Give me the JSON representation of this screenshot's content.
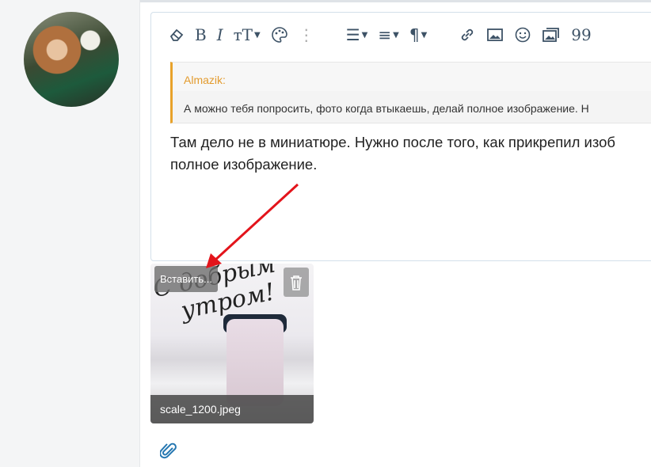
{
  "toolbar": {
    "items": [
      "eraser-icon",
      "bold-icon",
      "italic-icon",
      "text-size-icon",
      "palette-icon",
      "more-icon",
      "list-icon",
      "align-icon",
      "paragraph-icon",
      "link-icon",
      "image-icon",
      "smile-icon",
      "gallery-icon",
      "quote-icon"
    ],
    "bold": "B",
    "italic": "I",
    "text_size": "тT",
    "paragraph": "¶"
  },
  "quote": {
    "author": "Almazik:",
    "text": "А можно тебя попросить, фото когда втыкаешь, делай полное изображение. Н"
  },
  "message": {
    "line1": "Там дело не в миниатюре. Нужно после того, как прикрепил изоб",
    "line2": "полное изображение."
  },
  "attachment": {
    "insert_label": "Вставить...",
    "filename": "scale_1200.jpeg",
    "image_text": "С добрым утром!"
  },
  "colors": {
    "accent": "#e8a22b",
    "arrow": "#e3141b",
    "icon": "#3d5266"
  }
}
